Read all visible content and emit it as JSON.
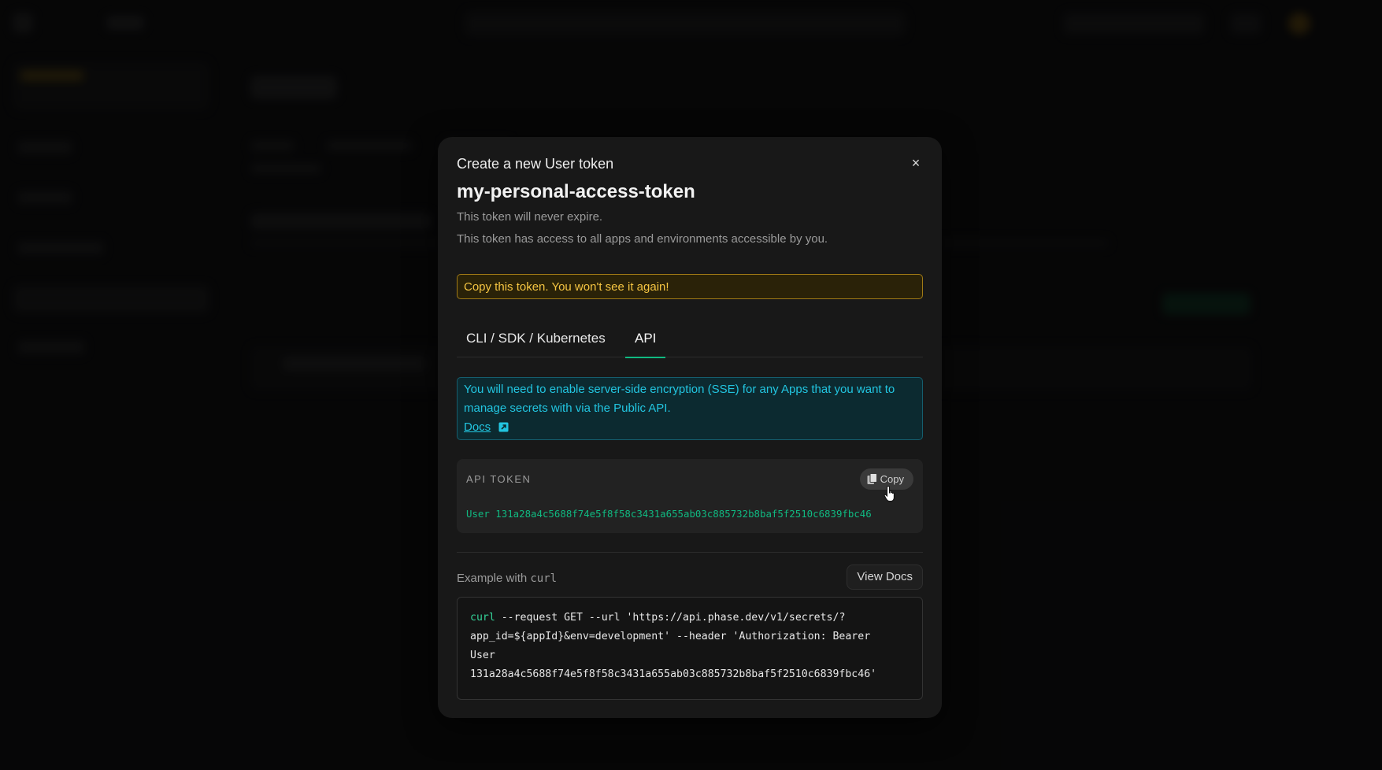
{
  "modal": {
    "heading": "Create a new User token",
    "close_glyph": "×",
    "token_name": "my-personal-access-token",
    "expiry_note": "This token will never expire.",
    "access_note": "This token has access to all apps and environments accessible by you.",
    "warning": "Copy this token. You won't see it again!",
    "tabs": [
      {
        "label": "CLI / SDK / Kubernetes",
        "active": false
      },
      {
        "label": "API",
        "active": true
      }
    ],
    "info": {
      "line1": "You will need to enable server-side encryption (SSE) for any Apps that you want to",
      "line2": "manage secrets with via the Public API.",
      "docs_link": "Docs",
      "docs_icon": "external-link-icon"
    },
    "api_token": {
      "label": "API TOKEN",
      "copy_label": "Copy",
      "copy_icon": "copy-icon",
      "value": "User 131a28a4c5688f74e5f8f58c3431a655ab03c885732b8baf5f2510c6839fbc46"
    },
    "example": {
      "label_prefix": "Example with ",
      "label_code": "curl",
      "view_docs_label": "View Docs",
      "code_cmd": "curl",
      "code_line1_rest": " --request GET --url 'https://api.phase.dev/v1/secrets/?",
      "code_line2": "app_id=${appId}&env=development' --header 'Authorization: Bearer",
      "code_line3": "User",
      "code_line4": "131a28a4c5688f74e5f8f58c3431a655ab03c885732b8baf5f2510c6839fbc46'"
    }
  },
  "colors": {
    "accent_green": "#10b981",
    "warning_yellow": "#f5c542",
    "info_cyan": "#22c5e0",
    "modal_bg": "#181818"
  }
}
